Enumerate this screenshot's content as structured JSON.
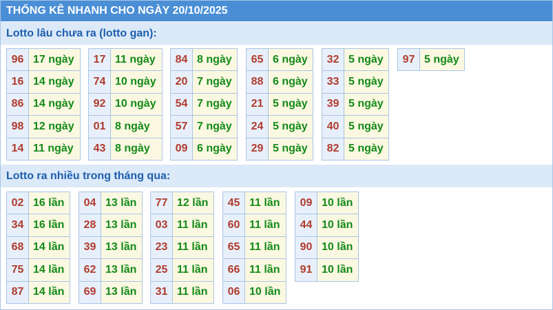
{
  "title": "THỐNG KÊ NHANH CHO NGÀY 20/10/2025",
  "gan": {
    "heading": "Lotto lâu chưa ra (lotto gan):",
    "groups": [
      [
        [
          "96",
          "17 ngày"
        ],
        [
          "16",
          "14 ngày"
        ],
        [
          "86",
          "14 ngày"
        ],
        [
          "98",
          "12 ngày"
        ],
        [
          "14",
          "11 ngày"
        ]
      ],
      [
        [
          "17",
          "11 ngày"
        ],
        [
          "74",
          "10 ngày"
        ],
        [
          "92",
          "10 ngày"
        ],
        [
          "01",
          "8 ngày"
        ],
        [
          "43",
          "8 ngày"
        ]
      ],
      [
        [
          "84",
          "8 ngày"
        ],
        [
          "20",
          "7 ngày"
        ],
        [
          "54",
          "7 ngày"
        ],
        [
          "57",
          "7 ngày"
        ],
        [
          "09",
          "6 ngày"
        ]
      ],
      [
        [
          "65",
          "6 ngày"
        ],
        [
          "88",
          "6 ngày"
        ],
        [
          "21",
          "5 ngày"
        ],
        [
          "24",
          "5 ngày"
        ],
        [
          "29",
          "5 ngày"
        ]
      ],
      [
        [
          "32",
          "5 ngày"
        ],
        [
          "33",
          "5 ngày"
        ],
        [
          "39",
          "5 ngày"
        ],
        [
          "40",
          "5 ngày"
        ],
        [
          "82",
          "5 ngày"
        ]
      ],
      [
        [
          "97",
          "5 ngày"
        ]
      ]
    ]
  },
  "frequent": {
    "heading": "Lotto ra nhiều trong tháng qua:",
    "groups": [
      [
        [
          "02",
          "16 lần"
        ],
        [
          "34",
          "16 lần"
        ],
        [
          "68",
          "14 lần"
        ],
        [
          "75",
          "14 lần"
        ],
        [
          "87",
          "14 lần"
        ]
      ],
      [
        [
          "04",
          "13 lần"
        ],
        [
          "28",
          "13 lần"
        ],
        [
          "39",
          "13 lần"
        ],
        [
          "62",
          "13 lần"
        ],
        [
          "69",
          "13 lần"
        ]
      ],
      [
        [
          "77",
          "12 lần"
        ],
        [
          "03",
          "11 lần"
        ],
        [
          "23",
          "11 lần"
        ],
        [
          "25",
          "11 lần"
        ],
        [
          "31",
          "11 lần"
        ]
      ],
      [
        [
          "45",
          "11 lần"
        ],
        [
          "60",
          "11 lần"
        ],
        [
          "65",
          "11 lần"
        ],
        [
          "66",
          "11 lần"
        ],
        [
          "06",
          "10 lần"
        ]
      ],
      [
        [
          "09",
          "10 lần"
        ],
        [
          "44",
          "10 lần"
        ],
        [
          "90",
          "10 lần"
        ],
        [
          "91",
          "10 lần"
        ]
      ]
    ]
  },
  "colors": {
    "title_bg": "#4a8fd6",
    "section_bg": "#dce9f8",
    "number_text": "#b03a2e",
    "count_text": "#138a17"
  }
}
